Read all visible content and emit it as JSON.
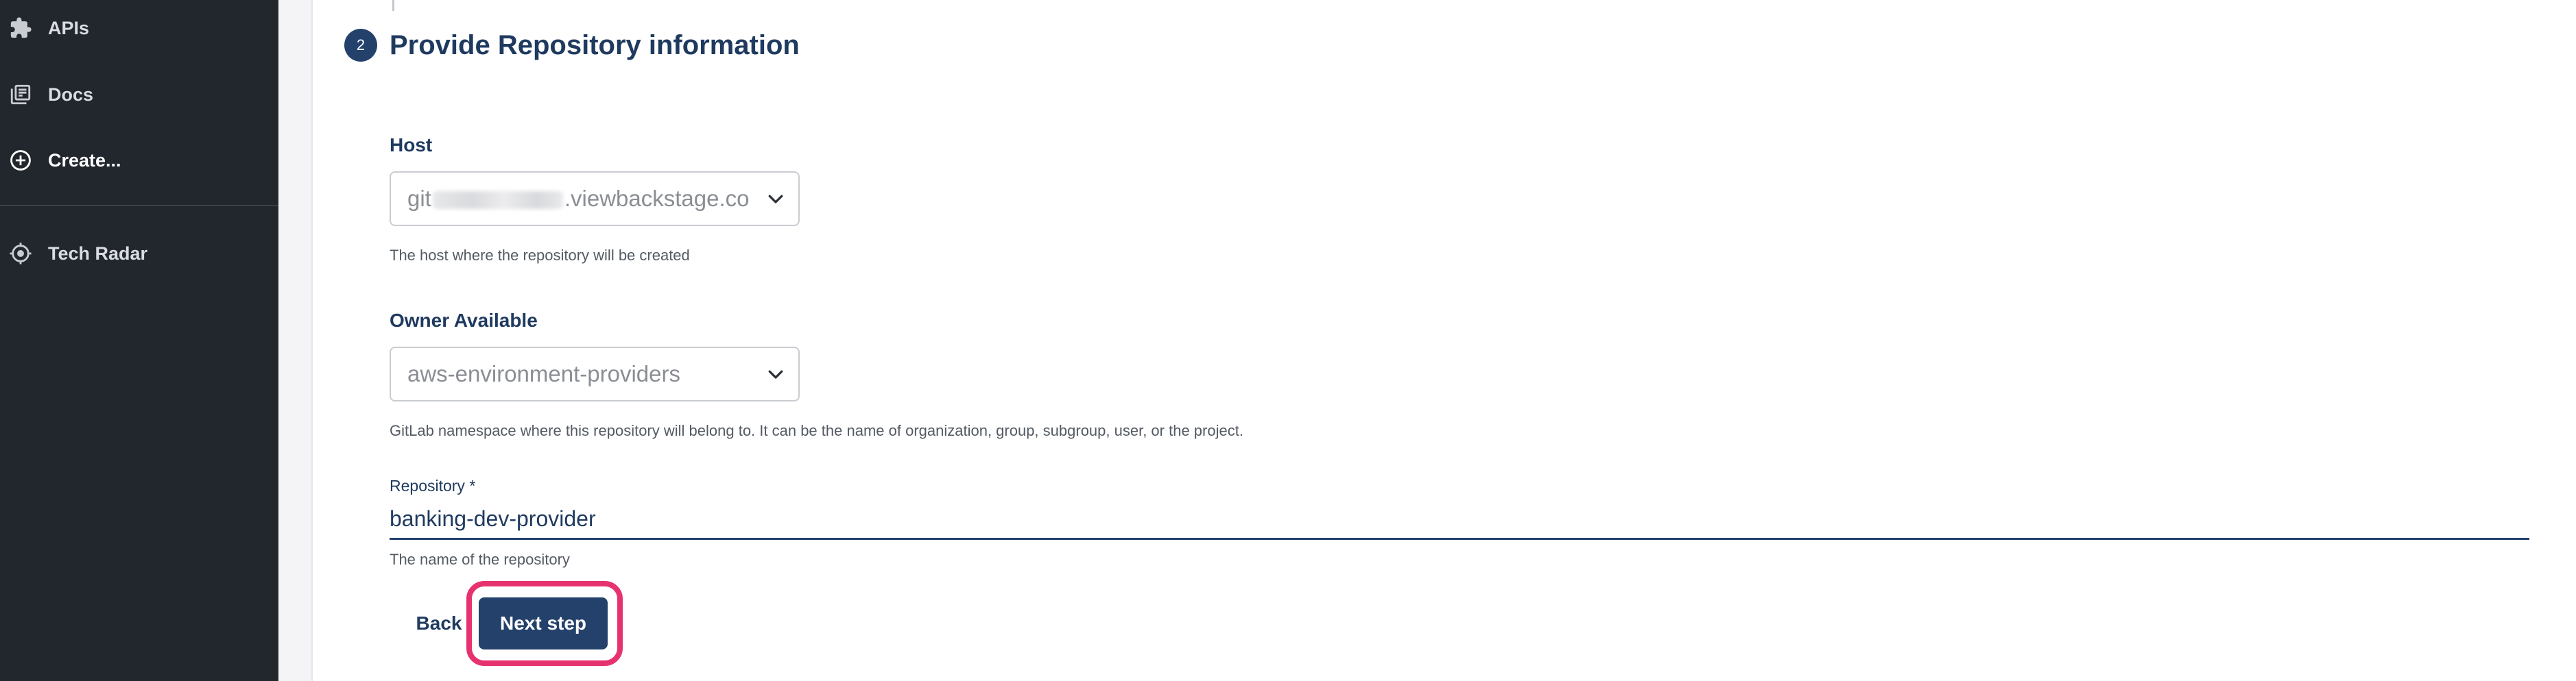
{
  "sidebar": {
    "items": [
      {
        "label": "APIs",
        "icon": "puzzle-icon"
      },
      {
        "label": "Docs",
        "icon": "docs-icon"
      },
      {
        "label": "Create...",
        "icon": "create-icon"
      },
      {
        "label": "Tech Radar",
        "icon": "radar-icon"
      }
    ]
  },
  "step": {
    "number": "2",
    "title": "Provide Repository information"
  },
  "form": {
    "host": {
      "label": "Host",
      "value_prefix": "git",
      "value_suffix": ".viewbackstage.co",
      "helper": "The host where the repository will be created"
    },
    "owner": {
      "label": "Owner Available",
      "value": "aws-environment-providers",
      "helper": "GitLab namespace where this repository will belong to. It can be the name of organization, group, subgroup, user, or the project."
    },
    "repository": {
      "label": "Repository *",
      "value": "banking-dev-provider",
      "helper": "The name of the repository"
    }
  },
  "actions": {
    "back_label": "Back",
    "next_label": "Next step"
  },
  "colors": {
    "sidebar_bg": "#22272e",
    "primary": "#23416b",
    "highlight": "#e6336f"
  }
}
